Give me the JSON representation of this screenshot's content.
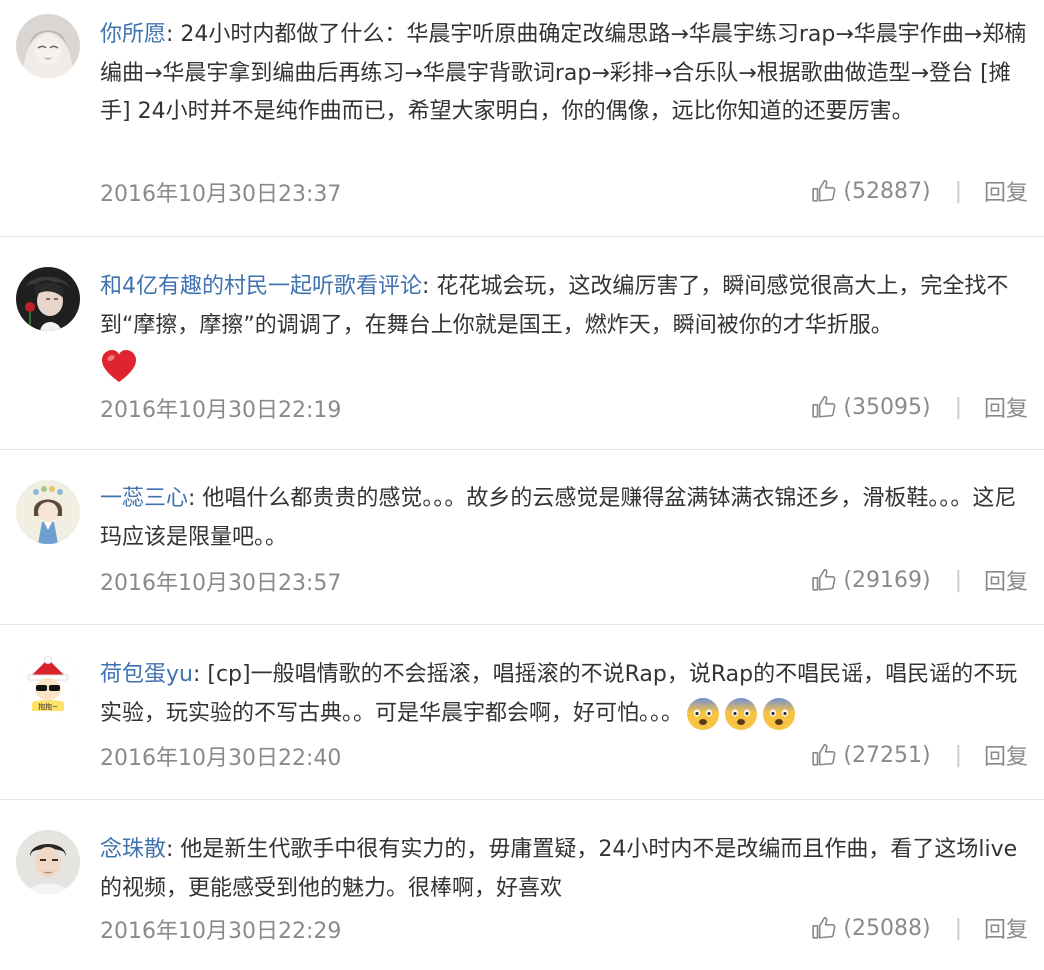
{
  "comments": [
    {
      "author": "你所愿",
      "sep": ": ",
      "text": "24小时内都做了什么：华晨宇听原曲确定改编思路→华晨宇练习rap→华晨宇作曲→郑楠编曲→华晨宇拿到编曲后再练习→华晨宇背歌词rap→彩排→合乐队→根据歌曲做造型→登台 [摊手] 24小时并不是纯作曲而已，希望大家明白，你的偶像，远比你知道的还要厉害。",
      "time": "2016年10月30日23:37",
      "likes": "(52887)",
      "reply": "回复",
      "divider": "|"
    },
    {
      "author": "和4亿有趣的村民一起听歌看评论",
      "sep": ": ",
      "text": "花花城会玩，这改编厉害了，瞬间感觉很高大上，完全找不到“摩擦，摩擦”的调调了，在舞台上你就是国王，燃炸天，瞬间被你的才华折服。",
      "emoji": "heart-emoji",
      "time": "2016年10月30日22:19",
      "likes": "(35095)",
      "reply": "回复",
      "divider": "|"
    },
    {
      "author": "一蕊三心",
      "sep": ": ",
      "text": "他唱什么都贵贵的感觉。。。故乡的云感觉是赚得盆满钵满衣锦还乡，滑板鞋。。。这尼玛应该是限量吧。。",
      "time": "2016年10月30日23:57",
      "likes": "(29169)",
      "reply": "回复",
      "divider": "|"
    },
    {
      "author": "荷包蛋yu",
      "sep": ": ",
      "text": "[cp]一般唱情歌的不会摇滚，唱摇滚的不说Rap，说Rap的不唱民谣，唱民谣的不玩实验，玩实验的不写古典。。可是华晨宇都会啊，好可怕。。。",
      "emoji": "fearful-face-emoji",
      "time": "2016年10月30日22:40",
      "likes": "(27251)",
      "reply": "回复",
      "divider": "|"
    },
    {
      "author": "念珠散",
      "sep": ": ",
      "text": "他是新生代歌手中很有实力的，毋庸置疑，24小时内不是改编而且作曲，看了这场live的视频，更能感受到他的魅力。很棒啊，好喜欢",
      "time": "2016年10月30日22:29",
      "likes": "(25088)",
      "reply": "回复",
      "divider": "|"
    }
  ],
  "avatar_labels": {
    "c4": "抱抱~"
  },
  "colors": {
    "author": "#3f72af",
    "text": "#333333",
    "meta": "#8a8a8a",
    "divider_line": "#e8e8e8"
  },
  "icons": {
    "like": "thumbs-up-icon"
  }
}
